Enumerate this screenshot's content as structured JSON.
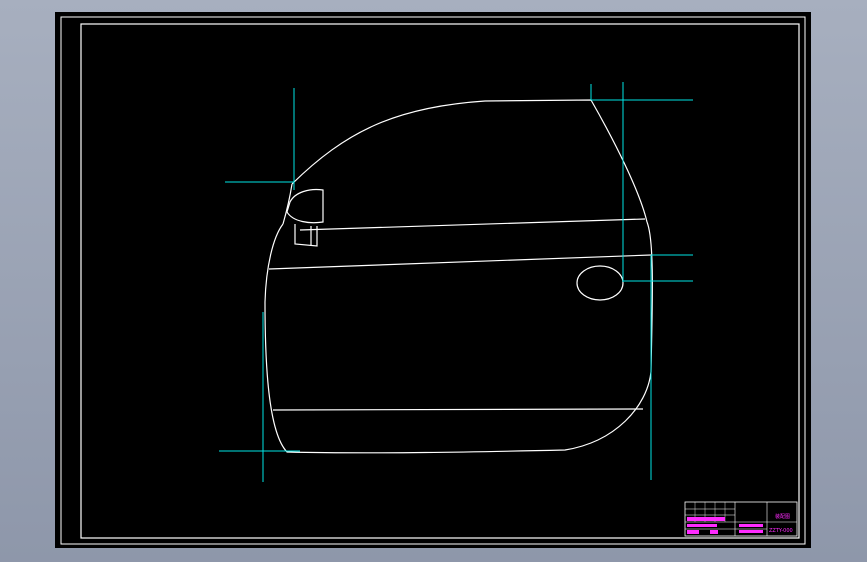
{
  "colors": {
    "background": "#000000",
    "frame": "#ffffff",
    "outline": "#ffffff",
    "dimension": "#00e5e5",
    "titleblock_text": "#ff2bff"
  },
  "drawing": {
    "subject": "car-door-outline",
    "title_block": {
      "label_top": "装配图",
      "label_bottom": "ZZTY-000"
    }
  }
}
